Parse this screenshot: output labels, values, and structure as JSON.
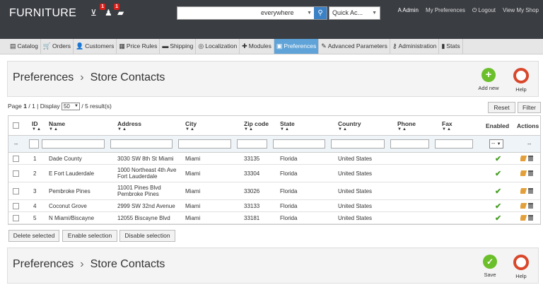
{
  "header": {
    "brand": "FURNITURE",
    "cart_badge": "1",
    "customers_badge": "1",
    "search": {
      "value": "",
      "scope": "everywhere"
    },
    "quick_access": "Quick Ac...",
    "user": "A Admin",
    "my_preferences": "My Preferences",
    "logout": "Logout",
    "view_shop": "View My Shop"
  },
  "tabs": [
    {
      "label": "Catalog",
      "icon": "folder-icon",
      "glyph": "▤"
    },
    {
      "label": "Orders",
      "icon": "cart-icon",
      "glyph": "🛒"
    },
    {
      "label": "Customers",
      "icon": "user-icon",
      "glyph": "👤"
    },
    {
      "label": "Price Rules",
      "icon": "price-tag-icon",
      "glyph": "▦"
    },
    {
      "label": "Shipping",
      "icon": "truck-icon",
      "glyph": "▬"
    },
    {
      "label": "Localization",
      "icon": "globe-icon",
      "glyph": "◎"
    },
    {
      "label": "Modules",
      "icon": "puzzle-icon",
      "glyph": "✚"
    },
    {
      "label": "Preferences",
      "icon": "preferences-icon",
      "glyph": "▣"
    },
    {
      "label": "Advanced Parameters",
      "icon": "wrench-icon",
      "glyph": "✎"
    },
    {
      "label": "Administration",
      "icon": "key-icon",
      "glyph": "⚷"
    },
    {
      "label": "Stats",
      "icon": "bar-chart-icon",
      "glyph": "▮"
    }
  ],
  "breadcrumb": {
    "section": "Preferences",
    "separator": "›",
    "page": "Store Contacts"
  },
  "toolbar": {
    "add_new": "Add new",
    "help": "Help",
    "save": "Save"
  },
  "pagination": {
    "prefix": "Page",
    "current": "1",
    "total": "1",
    "display_label": "Display",
    "per_page": "50",
    "results": "/ 5 result(s)"
  },
  "buttons": {
    "reset": "Reset",
    "filter": "Filter",
    "delete_selected": "Delete selected",
    "enable_selection": "Enable selection",
    "disable_selection": "Disable selection"
  },
  "columns": [
    "ID",
    "Name",
    "Address",
    "City",
    "Zip code",
    "State",
    "Country",
    "Phone",
    "Fax",
    "Enabled",
    "Actions"
  ],
  "filter_row": {
    "lead": "--",
    "enabled": "--",
    "actions": "--"
  },
  "rows": [
    {
      "id": "1",
      "name": "Dade County",
      "address": [
        "3030 SW 8th St Miami"
      ],
      "city": "Miami",
      "zip": "33135",
      "state": "Florida",
      "country": "United States",
      "phone": "",
      "fax": "",
      "enabled": true
    },
    {
      "id": "2",
      "name": "E Fort Lauderdale",
      "address": [
        "1000 Northeast 4th Ave",
        "Fort Lauderdale"
      ],
      "city": "Miami",
      "zip": "33304",
      "state": "Florida",
      "country": "United States",
      "phone": "",
      "fax": "",
      "enabled": true
    },
    {
      "id": "3",
      "name": "Pembroke Pines",
      "address": [
        "11001 Pines Blvd",
        "Pembroke Pines"
      ],
      "city": "Miami",
      "zip": "33026",
      "state": "Florida",
      "country": "United States",
      "phone": "",
      "fax": "",
      "enabled": true
    },
    {
      "id": "4",
      "name": "Coconut Grove",
      "address": [
        "2999 SW 32nd Avenue"
      ],
      "city": "Miami",
      "zip": "33133",
      "state": "Florida",
      "country": "United States",
      "phone": "",
      "fax": "",
      "enabled": true
    },
    {
      "id": "5",
      "name": "N Miami/Biscayne",
      "address": [
        "12055 Biscayne Blvd"
      ],
      "city": "Miami",
      "zip": "33181",
      "state": "Florida",
      "country": "United States",
      "phone": "",
      "fax": "",
      "enabled": true
    }
  ],
  "colors": {
    "header_bg": "#3a3d42",
    "active_tab": "#5fa3d8",
    "accent_green": "#6bbf2b",
    "badge_red": "#d9201b"
  }
}
